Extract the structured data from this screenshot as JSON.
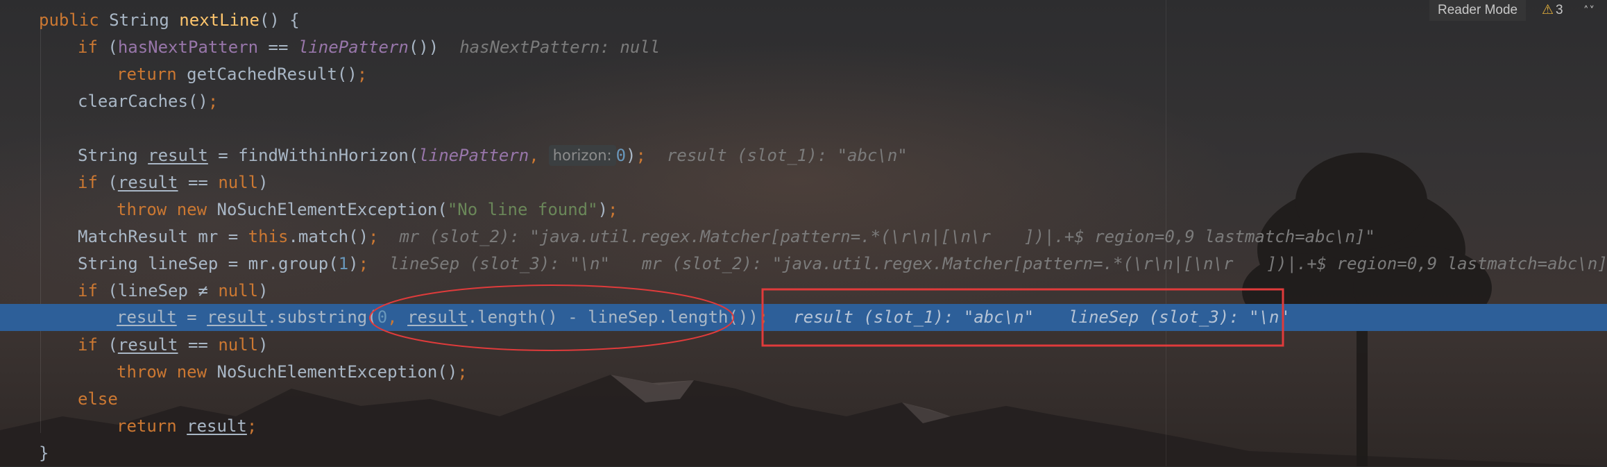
{
  "toolbar": {
    "reader_mode_label": "Reader Mode",
    "warning_count": "3",
    "warning_icon": "warning-triangle-icon"
  },
  "code": {
    "l1": {
      "a": "public",
      "b": " String ",
      "c": "nextLine",
      "d": "() {"
    },
    "l2": {
      "a": "if",
      "b": " (",
      "c": "hasNextPattern",
      "d": " == ",
      "e": "linePattern",
      "f": "())",
      "hint": "hasNextPattern: null"
    },
    "l3": {
      "a": "return",
      "b": " getCachedResult()",
      "c": ";"
    },
    "l4": {
      "a": "clearCaches()",
      "b": ";"
    },
    "l6": {
      "a": "String ",
      "b": "result",
      "c": " = findWithinHorizon(",
      "d": "linePattern",
      "e": ",",
      "param": "horizon:",
      "f": "0",
      "g": ")",
      "h": ";",
      "hint": "result (slot_1): \"abc\\n\""
    },
    "l7": {
      "a": "if",
      "b": " (",
      "c": "result",
      "d": " == ",
      "e": "null",
      "f": ")"
    },
    "l8": {
      "a": "throw new",
      "b": " NoSuchElementException(",
      "c": "\"No line found\"",
      "d": ")",
      "e": ";"
    },
    "l9": {
      "a": "MatchResult mr = ",
      "b": "this",
      "c": ".match()",
      "d": ";",
      "hint": "mr (slot_2): \"java.util.regex.Matcher[pattern=.*(\\r\\n|[\\n\\r  ])|.+$ region=0,9 lastmatch=abc\\n]\""
    },
    "l10": {
      "a": "String lineSep = mr.group(",
      "b": "1",
      "c": ")",
      "d": ";",
      "hint1": "lineSep (slot_3): \"\\n\"",
      "hint2": "mr (slot_2): \"java.util.regex.Matcher[pattern=.*(\\r\\n|[\\n\\r  ])|.+$ region=0,9 lastmatch=abc\\n]\""
    },
    "l11": {
      "a": "if",
      "b": " (lineSep ",
      "c": "≠",
      "d": " ",
      "e": "null",
      "f": ")"
    },
    "l12": {
      "a": "result",
      "b": " = ",
      "c": "result",
      "d": ".substring(",
      "e": "0",
      "f": ", ",
      "g": "result",
      "h": ".length() - lineSep.length())",
      "i": ";",
      "hint1": "result (slot_1): \"abc\\n\"",
      "hint2": "lineSep (slot_3): \"\\n\""
    },
    "l13": {
      "a": "if",
      "b": " (",
      "c": "result",
      "d": " == ",
      "e": "null",
      "f": ")"
    },
    "l14": {
      "a": "throw new",
      "b": " NoSuchElementException()",
      "c": ";"
    },
    "l15": {
      "a": "else"
    },
    "l16": {
      "a": "return",
      "b": " ",
      "c": "result",
      "d": ";"
    },
    "l17": {
      "a": "}"
    }
  },
  "annotation": {
    "ellipse_color": "#e03b3b",
    "box_color": "#e03b3b"
  }
}
